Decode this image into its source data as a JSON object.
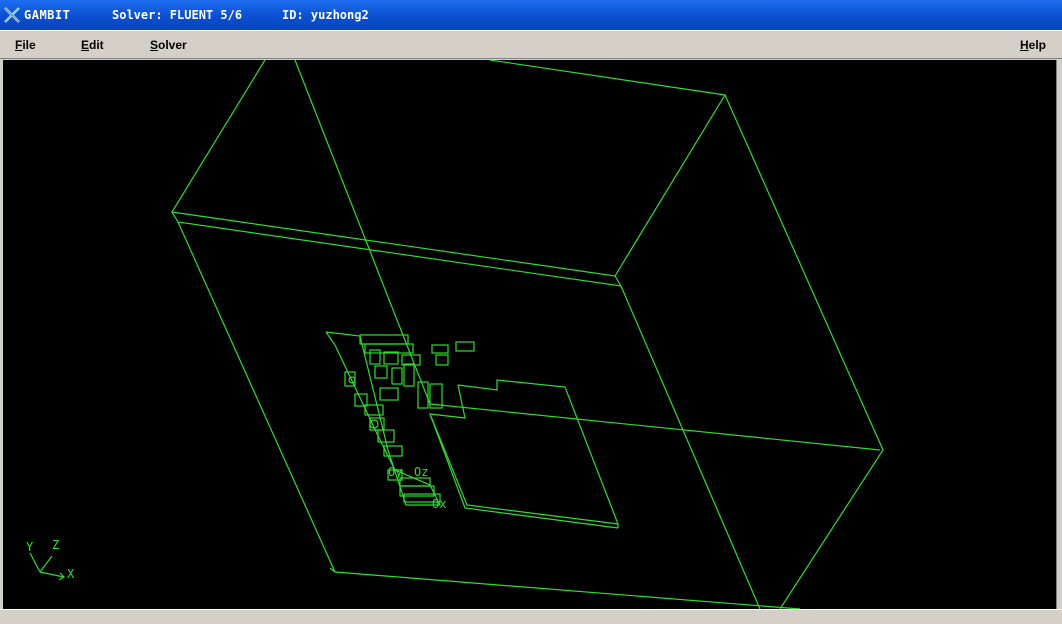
{
  "titlebar": {
    "app_name": "GAMBIT",
    "solver": "Solver: FLUENT 5/6",
    "id": "ID: yuzhong2"
  },
  "menu": {
    "file": "File",
    "edit": "Edit",
    "solver": "Solver",
    "help": "Help"
  },
  "viewport": {
    "line_color": "#2be02b",
    "background": "#000000",
    "triad": {
      "y": "Y",
      "z": "Z",
      "x": "X"
    },
    "local_axes": {
      "y": "Oy",
      "z": "Oz",
      "x": "Ox"
    }
  }
}
